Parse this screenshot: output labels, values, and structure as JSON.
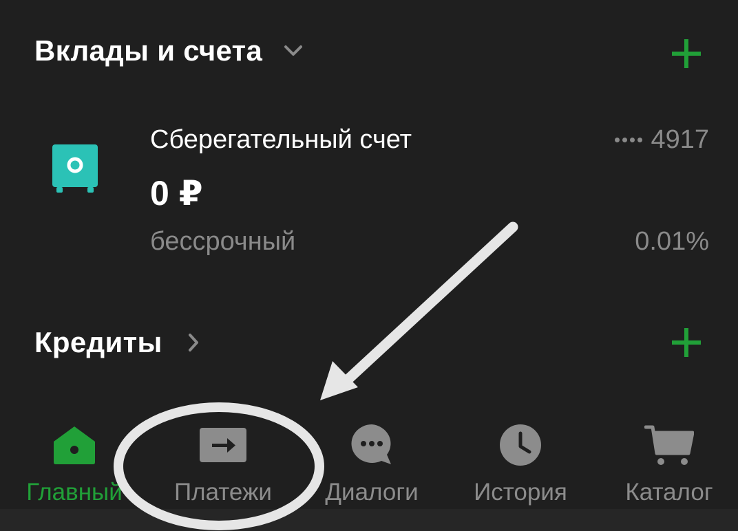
{
  "colors": {
    "background": "#1f1f1f",
    "accent_green": "#21a038",
    "muted_text": "#8a8a8a",
    "safe_icon": "#2bc2b6",
    "annotation": "#e6e6e6"
  },
  "deposits": {
    "title": "Вклады и счета",
    "chevron_icon": "chevron-down-icon",
    "add_icon": "plus-icon"
  },
  "account": {
    "icon": "safe-icon",
    "name": "Сберегательный счет",
    "balance": "0 ₽",
    "term": "бессрочный",
    "card_mask_icon": "masked-dots",
    "card_last4": "4917",
    "rate": "0.01%"
  },
  "credits": {
    "title": "Кредиты",
    "chevron_icon": "chevron-right-icon",
    "add_icon": "plus-icon"
  },
  "tabbar": {
    "active": "Главный",
    "items": [
      {
        "label": "Главный",
        "icon": "home-icon"
      },
      {
        "label": "Платежи",
        "icon": "payments-arrow-icon"
      },
      {
        "label": "Диалоги",
        "icon": "chat-bubble-icon"
      },
      {
        "label": "История",
        "icon": "clock-icon"
      },
      {
        "label": "Каталог",
        "icon": "cart-icon"
      }
    ]
  },
  "annotation": {
    "type": "arrow-and-ellipse",
    "target": "Платежи"
  }
}
